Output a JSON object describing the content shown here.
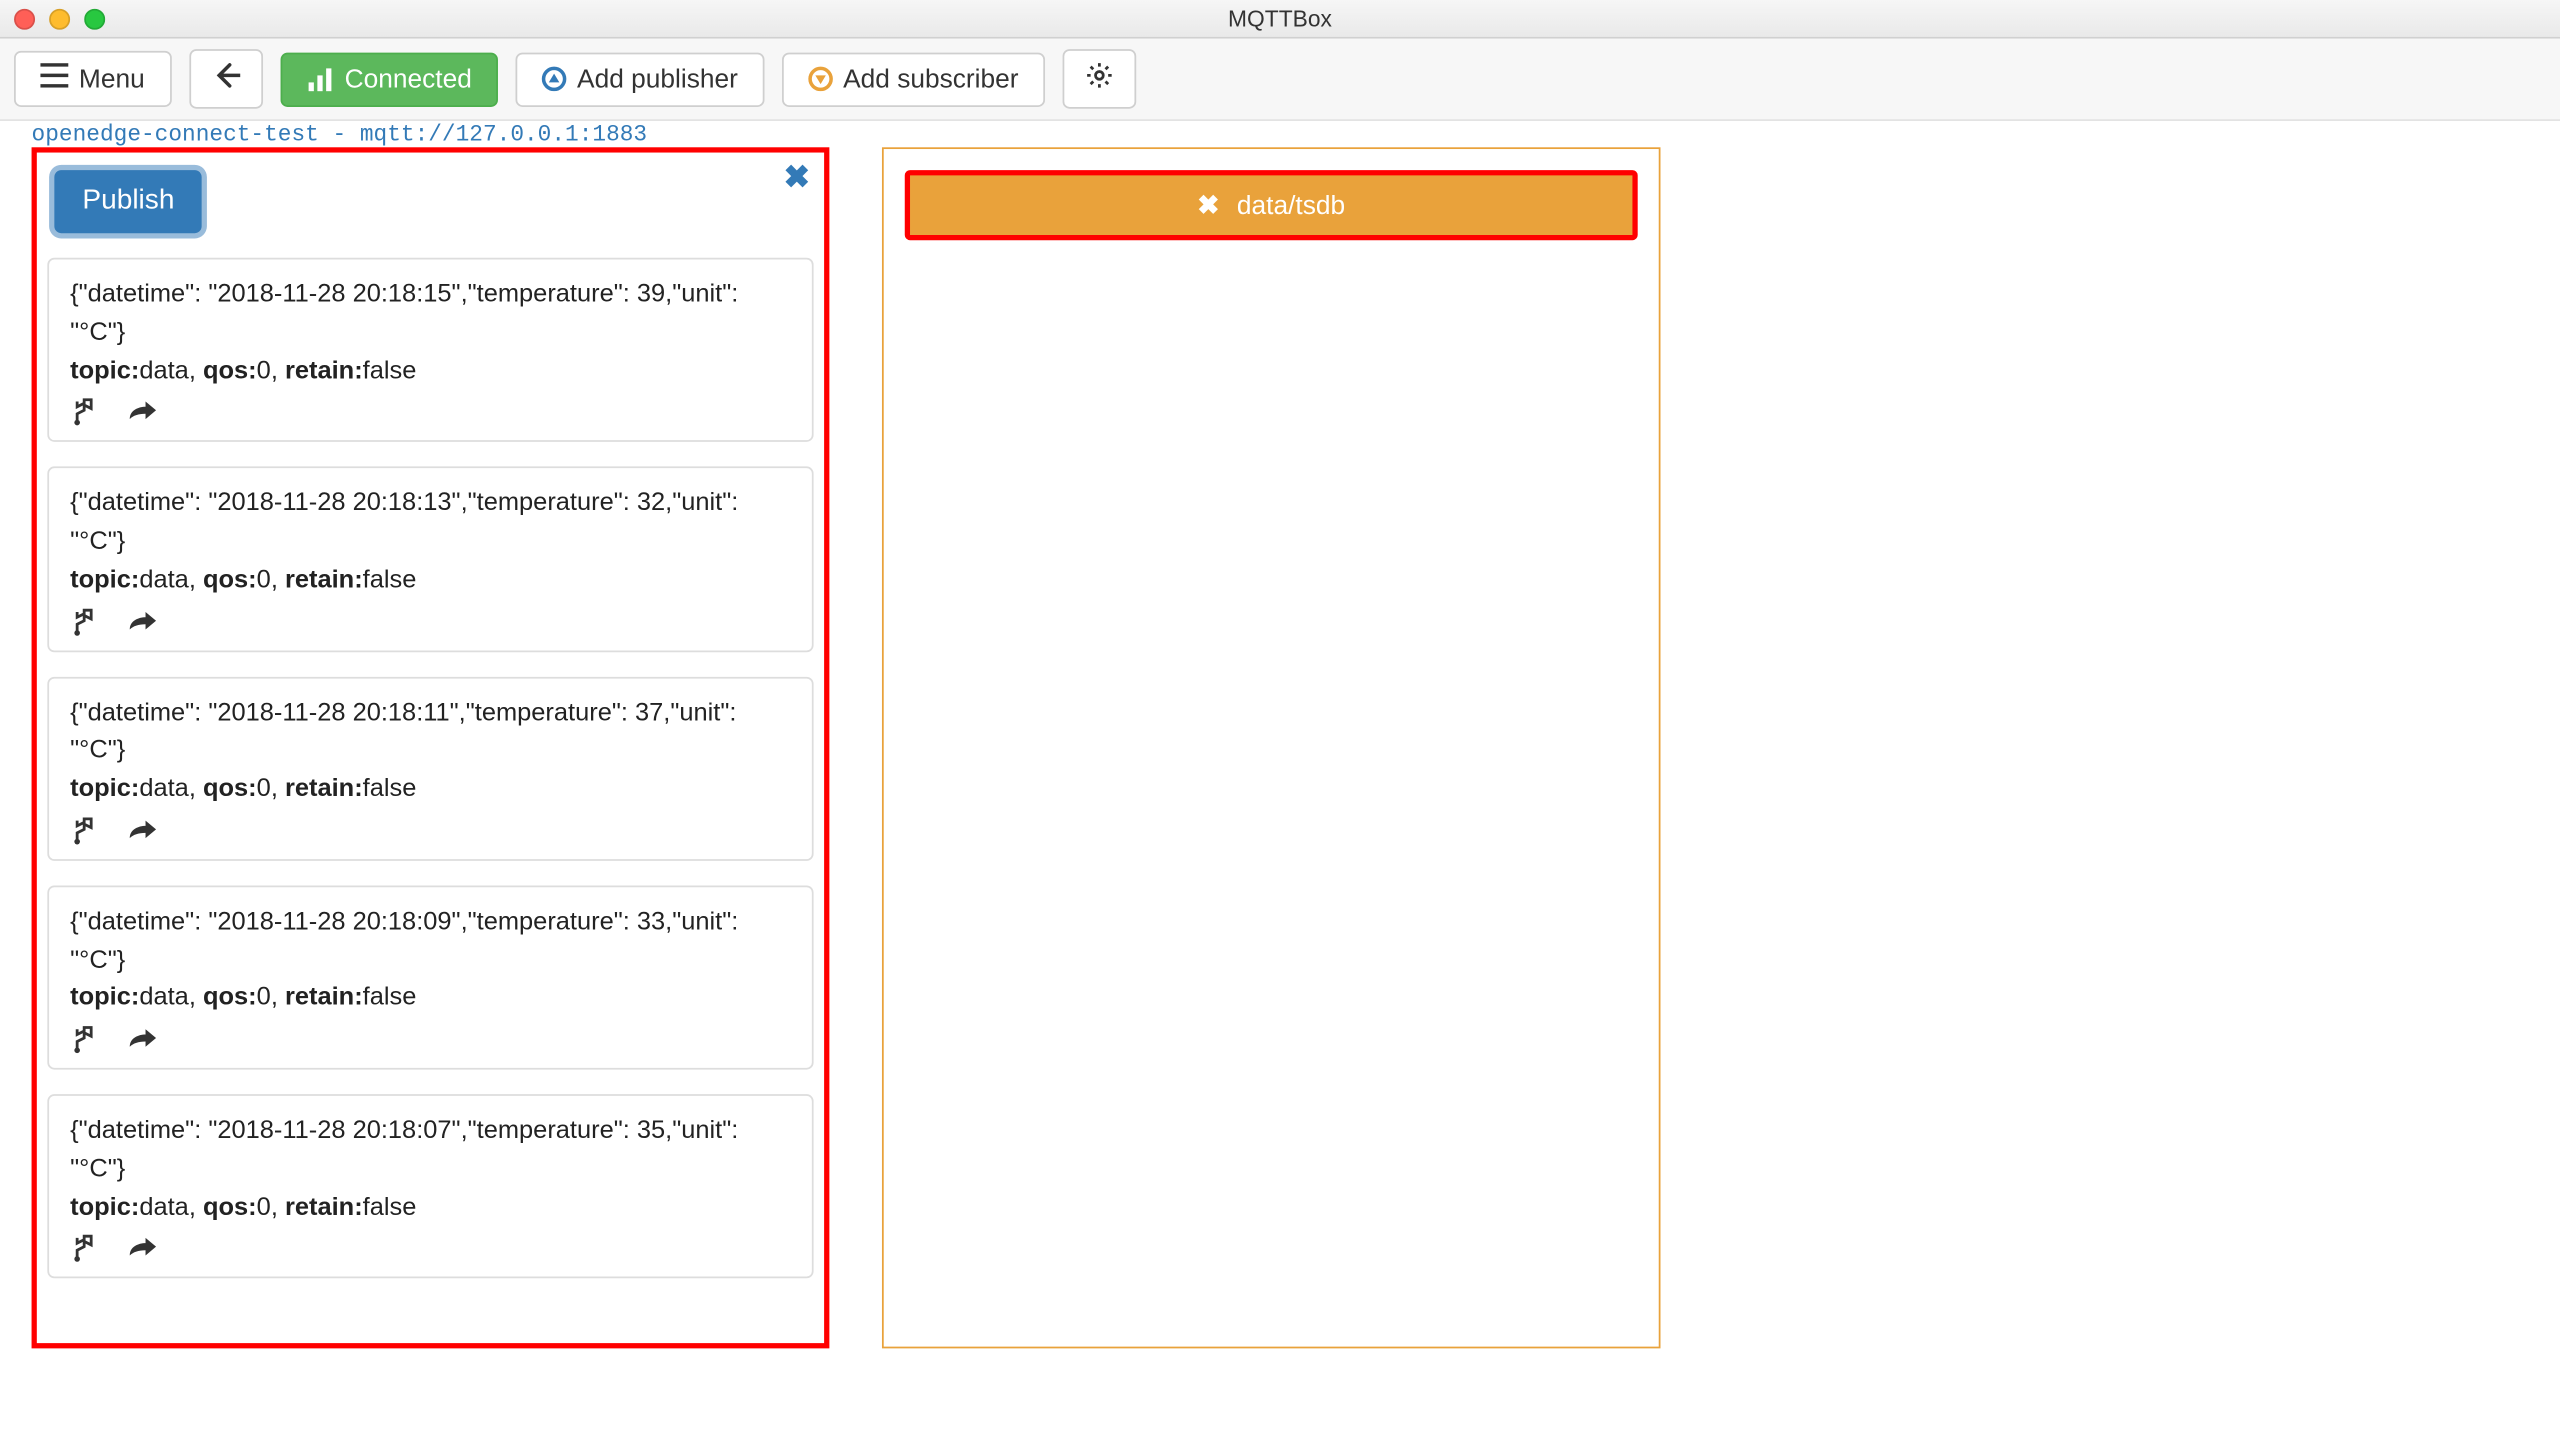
{
  "window": {
    "title": "MQTTBox"
  },
  "toolbar": {
    "menu_label": "Menu",
    "connected_label": "Connected",
    "add_publisher_label": "Add publisher",
    "add_subscriber_label": "Add subscriber"
  },
  "breadcrumb": "openedge-connect-test - mqtt://127.0.0.1:1883",
  "publisher": {
    "publish_label": "Publish",
    "messages": [
      {
        "payload": "{\"datetime\": \"2018-11-28 20:18:15\",\"temperature\": 39,\"unit\": \"°C\"}",
        "topic": "data",
        "qos": "0",
        "retain": "false"
      },
      {
        "payload": "{\"datetime\": \"2018-11-28 20:18:13\",\"temperature\": 32,\"unit\": \"°C\"}",
        "topic": "data",
        "qos": "0",
        "retain": "false"
      },
      {
        "payload": "{\"datetime\": \"2018-11-28 20:18:11\",\"temperature\": 37,\"unit\": \"°C\"}",
        "topic": "data",
        "qos": "0",
        "retain": "false"
      },
      {
        "payload": "{\"datetime\": \"2018-11-28 20:18:09\",\"temperature\": 33,\"unit\": \"°C\"}",
        "topic": "data",
        "qos": "0",
        "retain": "false"
      },
      {
        "payload": "{\"datetime\": \"2018-11-28 20:18:07\",\"temperature\": 35,\"unit\": \"°C\"}",
        "topic": "data",
        "qos": "0",
        "retain": "false"
      }
    ],
    "meta_labels": {
      "topic": "topic:",
      "qos": "qos:",
      "retain": "retain:"
    }
  },
  "subscriber": {
    "topic": "data/tsdb"
  }
}
